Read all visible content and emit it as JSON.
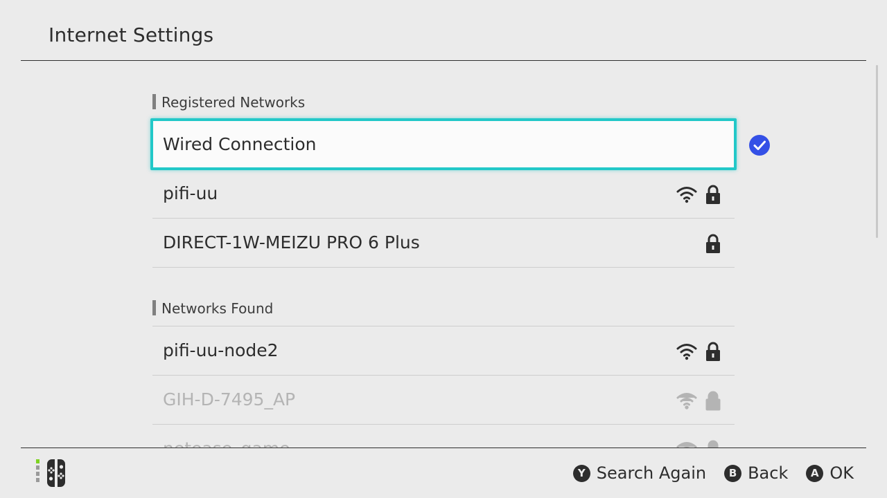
{
  "header": {
    "title": "Internet Settings"
  },
  "registered": {
    "title": "Registered Networks",
    "items": [
      {
        "label": "Wired Connection",
        "icons": [],
        "connected": true
      },
      {
        "label": "pifi-uu",
        "icons": [
          "wifi-icon",
          "lock-icon"
        ]
      },
      {
        "label": "DIRECT-1W-MEIZU PRO 6 Plus",
        "icons": [
          "lock-icon"
        ]
      }
    ]
  },
  "found": {
    "title": "Networks Found",
    "items": [
      {
        "label": "pifi-uu-node2",
        "icons": [
          "wifi-icon",
          "lock-icon"
        ],
        "dimmed": false
      },
      {
        "label": "GIH-D-7495_AP",
        "icons": [
          "wifi-icon",
          "lock-icon"
        ],
        "dimmed": true
      },
      {
        "label": "netease_game",
        "icons": [
          "wifi-icon",
          "lock-icon"
        ],
        "dimmed": true
      }
    ]
  },
  "footer": {
    "actions": [
      {
        "glyph": "Y",
        "label": "Search Again"
      },
      {
        "glyph": "B",
        "label": "Back"
      },
      {
        "glyph": "A",
        "label": "OK"
      }
    ]
  },
  "colors": {
    "background": "#ebebeb",
    "text": "#2d2d2d",
    "selection": "#22c8c8",
    "check": "#3450e6",
    "dimmed": "#b4b4b4",
    "joycon_indicator": "#7ed321"
  }
}
